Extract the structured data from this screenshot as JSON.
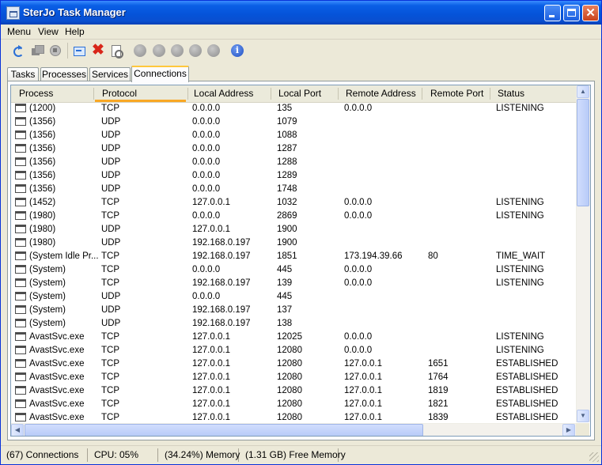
{
  "window": {
    "title": "SterJo Task Manager",
    "buttons": {
      "minimize": "minimize",
      "maximize": "maximize",
      "close": "✕"
    }
  },
  "menu": {
    "items": [
      "Menu",
      "View",
      "Help"
    ]
  },
  "toolbar": {
    "icons": [
      "refresh-icon",
      "windows-icon",
      "stop-icon",
      "switch-to-icon",
      "end-task-icon",
      "properties-icon",
      "disabled-icon",
      "disabled-icon",
      "disabled-icon",
      "disabled-icon",
      "disabled-icon",
      "about-icon"
    ],
    "kill_glyph": "✖",
    "info_glyph": "i"
  },
  "tabs": [
    {
      "label": "Tasks",
      "active": false
    },
    {
      "label": "Processes",
      "active": false
    },
    {
      "label": "Services",
      "active": false
    },
    {
      "label": "Connections",
      "active": true
    }
  ],
  "table": {
    "columns": [
      "Process",
      "Protocol",
      "Local Address",
      "Local Port",
      "Remote Address",
      "Remote Port",
      "Status"
    ],
    "sorted_column": "Protocol",
    "rows": [
      [
        "(1200)",
        "TCP",
        "0.0.0.0",
        "135",
        "0.0.0.0",
        "",
        "LISTENING"
      ],
      [
        "(1356)",
        "UDP",
        "0.0.0.0",
        "1079",
        "",
        "",
        ""
      ],
      [
        "(1356)",
        "UDP",
        "0.0.0.0",
        "1088",
        "",
        "",
        ""
      ],
      [
        "(1356)",
        "UDP",
        "0.0.0.0",
        "1287",
        "",
        "",
        ""
      ],
      [
        "(1356)",
        "UDP",
        "0.0.0.0",
        "1288",
        "",
        "",
        ""
      ],
      [
        "(1356)",
        "UDP",
        "0.0.0.0",
        "1289",
        "",
        "",
        ""
      ],
      [
        "(1356)",
        "UDP",
        "0.0.0.0",
        "1748",
        "",
        "",
        ""
      ],
      [
        "(1452)",
        "TCP",
        "127.0.0.1",
        "1032",
        "0.0.0.0",
        "",
        "LISTENING"
      ],
      [
        "(1980)",
        "TCP",
        "0.0.0.0",
        "2869",
        "0.0.0.0",
        "",
        "LISTENING"
      ],
      [
        "(1980)",
        "UDP",
        "127.0.0.1",
        "1900",
        "",
        "",
        ""
      ],
      [
        "(1980)",
        "UDP",
        "192.168.0.197",
        "1900",
        "",
        "",
        ""
      ],
      [
        "(System Idle Pr...",
        "TCP",
        "192.168.0.197",
        "1851",
        "173.194.39.66",
        "80",
        "TIME_WAIT"
      ],
      [
        "(System)",
        "TCP",
        "0.0.0.0",
        "445",
        "0.0.0.0",
        "",
        "LISTENING"
      ],
      [
        "(System)",
        "TCP",
        "192.168.0.197",
        "139",
        "0.0.0.0",
        "",
        "LISTENING"
      ],
      [
        "(System)",
        "UDP",
        "0.0.0.0",
        "445",
        "",
        "",
        ""
      ],
      [
        "(System)",
        "UDP",
        "192.168.0.197",
        "137",
        "",
        "",
        ""
      ],
      [
        "(System)",
        "UDP",
        "192.168.0.197",
        "138",
        "",
        "",
        ""
      ],
      [
        "AvastSvc.exe",
        "TCP",
        "127.0.0.1",
        "12025",
        "0.0.0.0",
        "",
        "LISTENING"
      ],
      [
        "AvastSvc.exe",
        "TCP",
        "127.0.0.1",
        "12080",
        "0.0.0.0",
        "",
        "LISTENING"
      ],
      [
        "AvastSvc.exe",
        "TCP",
        "127.0.0.1",
        "12080",
        "127.0.0.1",
        "1651",
        "ESTABLISHED"
      ],
      [
        "AvastSvc.exe",
        "TCP",
        "127.0.0.1",
        "12080",
        "127.0.0.1",
        "1764",
        "ESTABLISHED"
      ],
      [
        "AvastSvc.exe",
        "TCP",
        "127.0.0.1",
        "12080",
        "127.0.0.1",
        "1819",
        "ESTABLISHED"
      ],
      [
        "AvastSvc.exe",
        "TCP",
        "127.0.0.1",
        "12080",
        "127.0.0.1",
        "1821",
        "ESTABLISHED"
      ],
      [
        "AvastSvc.exe",
        "TCP",
        "127.0.0.1",
        "12080",
        "127.0.0.1",
        "1839",
        "ESTABLISHED"
      ]
    ]
  },
  "statusbar": {
    "connections": "(67) Connections",
    "cpu": "CPU: 05%",
    "memory": "(34.24%) Memory",
    "free_memory": "(1.31 GB) Free Memory"
  },
  "scrollbar_glyphs": {
    "up": "▲",
    "down": "▼",
    "left": "◀",
    "right": "▶"
  },
  "colors": {
    "titlebar": "#0553d8",
    "sort_indicator": "#f9a825",
    "close_button": "#c9421c"
  }
}
